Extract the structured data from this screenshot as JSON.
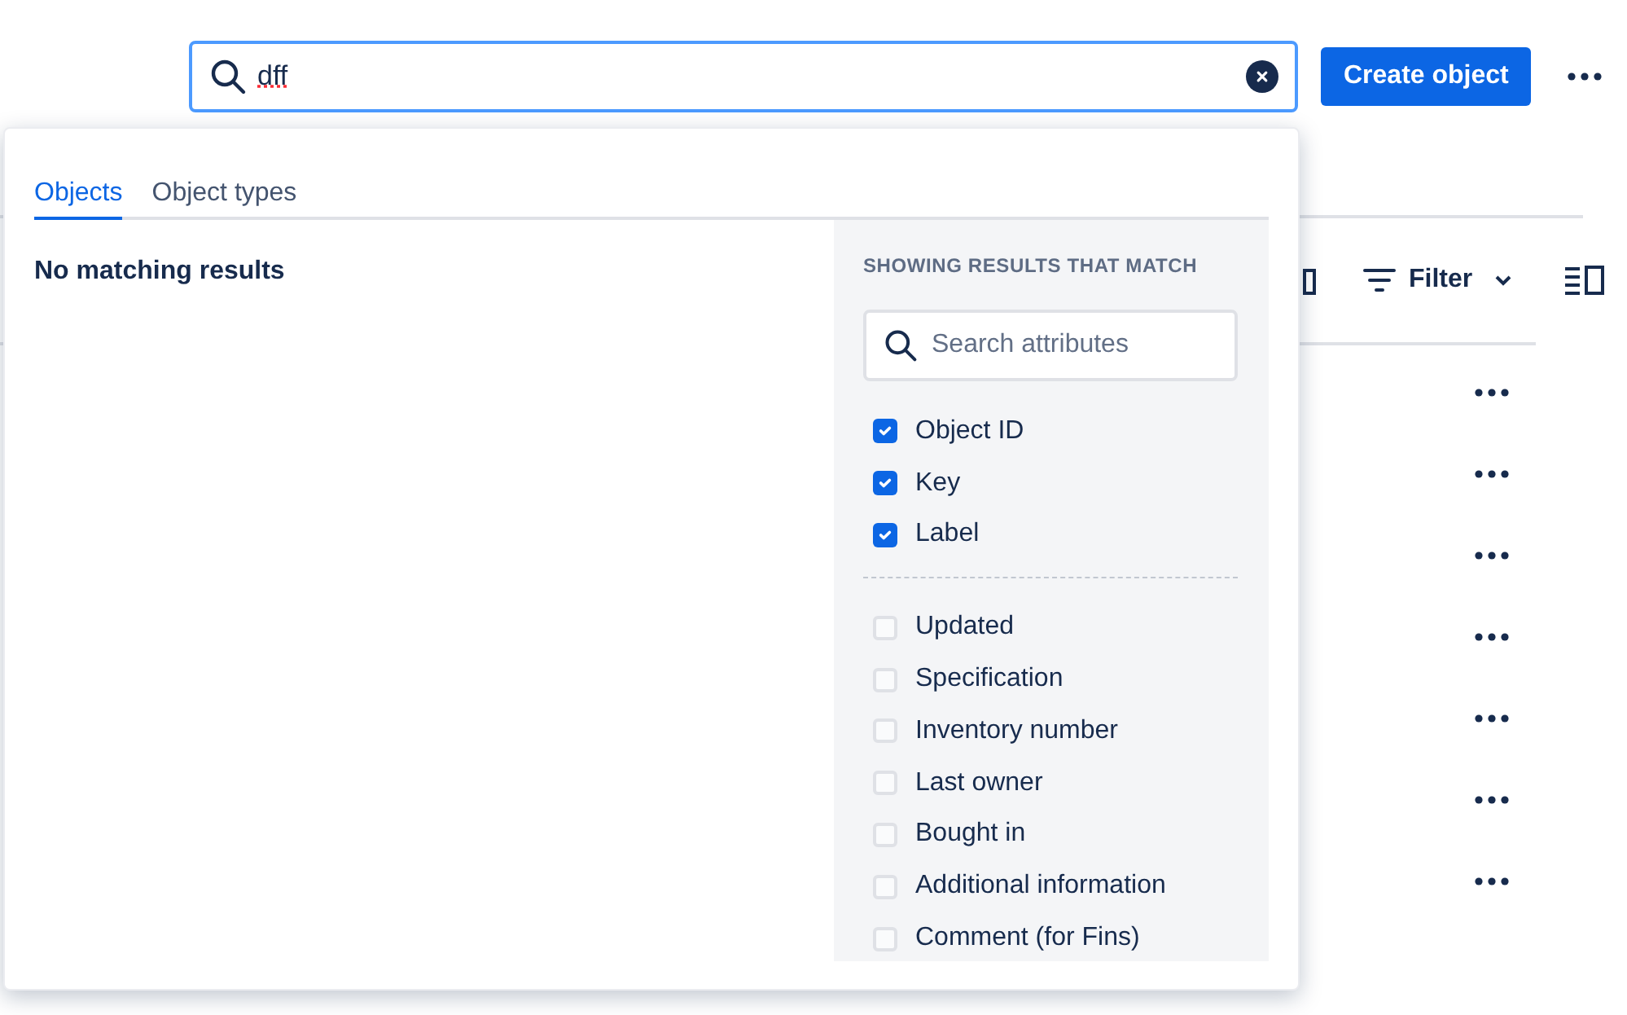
{
  "search": {
    "value": "dff"
  },
  "create_button": {
    "label": "Create object"
  },
  "toolbar": {
    "filter_label": "Filter"
  },
  "dropdown": {
    "tabs": [
      {
        "label": "Objects",
        "selected": true
      },
      {
        "label": "Object types",
        "selected": false
      }
    ],
    "empty_message": "No matching results",
    "attributes_heading": "SHOWING RESULTS THAT MATCH",
    "attribute_search": {
      "placeholder": "Search attributes"
    },
    "attribute_groups": [
      [
        {
          "label": "Object ID",
          "checked": true
        },
        {
          "label": "Key",
          "checked": true
        },
        {
          "label": "Label",
          "checked": true
        }
      ],
      [
        {
          "label": "Updated",
          "checked": false
        },
        {
          "label": "Specification",
          "checked": false
        },
        {
          "label": "Inventory number",
          "checked": false
        },
        {
          "label": "Last owner",
          "checked": false
        },
        {
          "label": "Bought in",
          "checked": false
        },
        {
          "label": "Additional information",
          "checked": false
        },
        {
          "label": "Comment (for Fins)",
          "checked": false
        }
      ]
    ]
  }
}
